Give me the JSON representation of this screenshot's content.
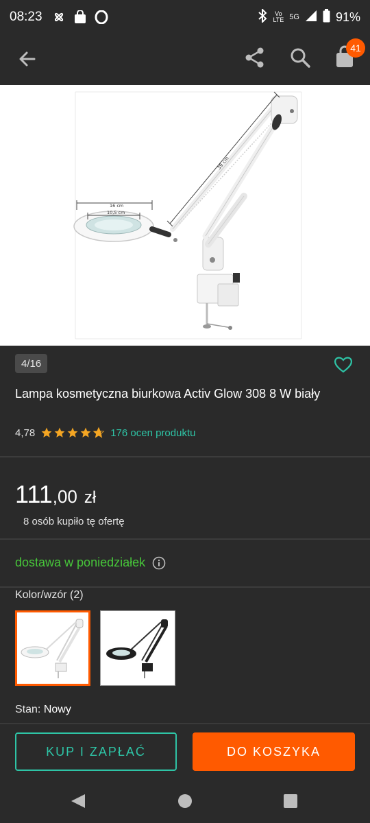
{
  "status_bar": {
    "time": "08:23",
    "network_labels": [
      "Vo",
      "LTE"
    ],
    "network_type": "5G",
    "battery": "91%"
  },
  "app_bar": {
    "cart_count": "41"
  },
  "product": {
    "image_counter": "4/16",
    "title": "Lampa kosmetyczna biurkowa Activ Glow 308 8 W biały",
    "rating": "4,78",
    "rating_stars": 4.78,
    "reviews_label": "176 ocen produktu",
    "price_main": "111",
    "price_cents": ",00",
    "price_currency": "zł",
    "bought_label": "8 osób kupiło tę ofertę",
    "delivery_label": "dostawa w poniedziałek",
    "variant_label": "Kolor/wzór (2)",
    "condition_label": "Stan:",
    "condition_value": "Nowy",
    "image_dimension_labels": [
      "39 cm",
      "16 cm",
      "10,5 cm"
    ]
  },
  "actions": {
    "buy_label": "KUP I ZAPŁAĆ",
    "cart_label": "DO KOSZYKA"
  },
  "colors": {
    "accent_teal": "#2ec4a6",
    "accent_orange": "#ff5a00",
    "delivery_green": "#47c53a",
    "background": "#2a2a2a"
  }
}
